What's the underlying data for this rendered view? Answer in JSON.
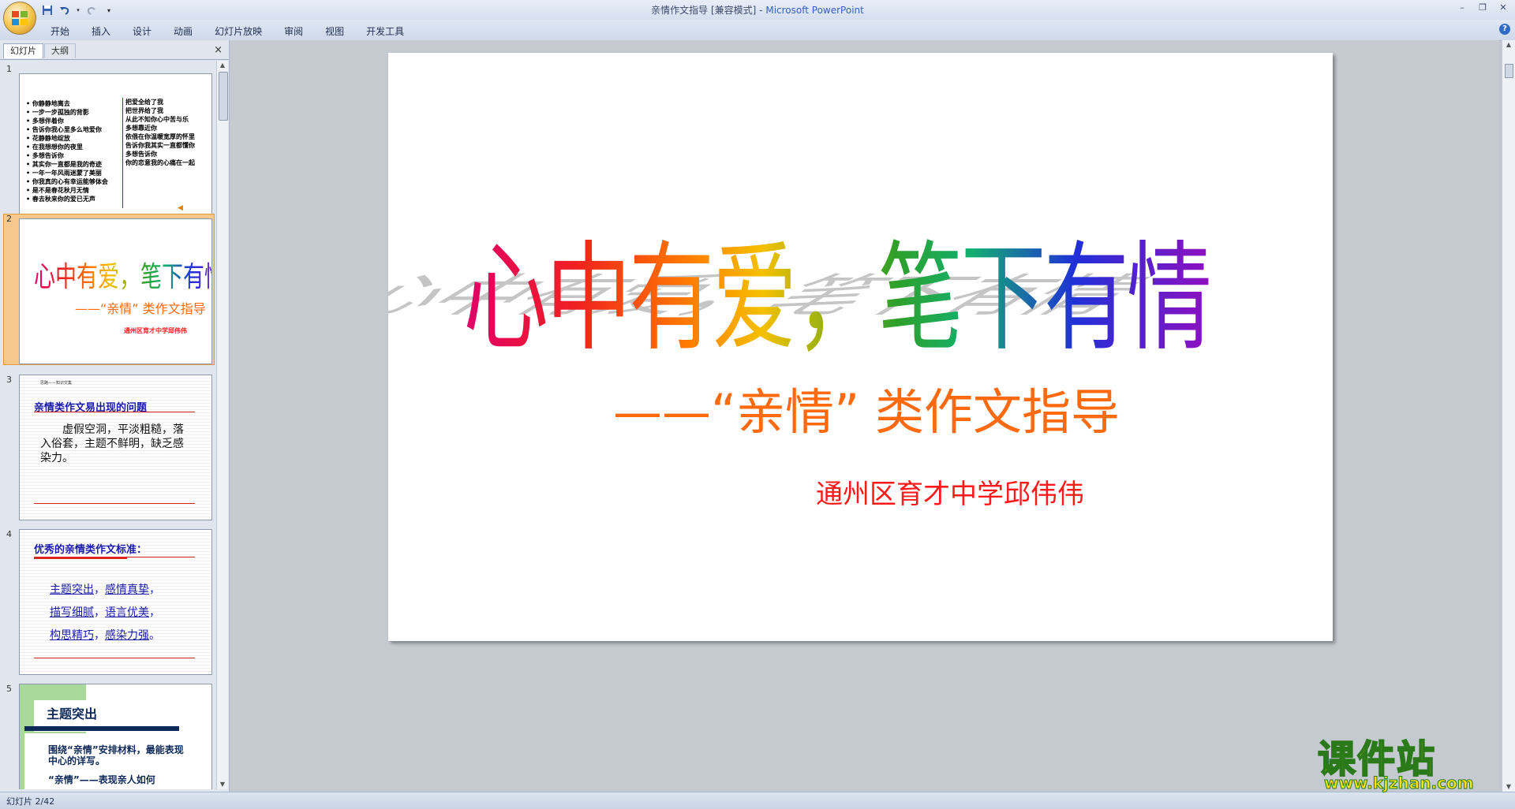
{
  "window": {
    "title_doc": "亲情作文指导 [兼容模式]",
    "title_app": "Microsoft PowerPoint",
    "separator": "-"
  },
  "ribbon": {
    "tabs": [
      "开始",
      "插入",
      "设计",
      "动画",
      "幻灯片放映",
      "审阅",
      "视图",
      "开发工具"
    ]
  },
  "left_panel": {
    "tab_slides": "幻灯片",
    "tab_outline": "大纲",
    "close": "×",
    "slide_numbers": [
      "1",
      "2",
      "3",
      "4",
      "5"
    ],
    "thumb1": {
      "left_lines": [
        "• 你静静地离去",
        "• 一步一步孤独的背影",
        "• 多想伴着你",
        "• 告诉你我心里多么地爱你",
        "• 花静静地绽放",
        "• 在我想想你的夜里",
        "• 多想告诉你",
        "• 其实你一直都是我的奇迹",
        "• 一年一年风雨迷蒙了美丽",
        "• 你我真的心有幸运能够体会",
        "• 是不是春花秋月无情",
        "• 春去秋来你的爱已无声"
      ],
      "right_lines": [
        "把爱全给了我",
        "把世界给了我",
        "从此不知你心中苦与乐",
        "多想靠近你",
        "依偎在你温暖宽厚的怀里",
        "告诉你我其实一直都懂你",
        "多想告诉你",
        "你的恋意我的心痛在一起"
      ]
    },
    "thumb2": {
      "title": "心中有爱，笔下有情",
      "subtitle": "——“亲情” 类作文指导",
      "author": "通州区育才中学邱伟伟"
    },
    "thumb3": {
      "header": "思路——知识交集",
      "title": "亲情类作文易出现的问题",
      "body": "虚假空洞，平淡粗糙，落入俗套，主题不鲜明，缺乏感染力。"
    },
    "thumb4": {
      "title": "优秀的亲情类作文标准：",
      "lines": [
        [
          "主题突出",
          "，",
          "感情真挚",
          "，"
        ],
        [
          "描写细腻",
          "，",
          "语言优美",
          "，"
        ],
        [
          "构思精巧",
          "，",
          "感染力强",
          "。"
        ]
      ]
    },
    "thumb5": {
      "title": "主题突出",
      "body1": "围绕“亲情”安排材料，最能表现中心的详写。",
      "body2": "“亲情”——表现亲人如何"
    }
  },
  "slide": {
    "title": "心中有爱，笔下有情",
    "subtitle": "——“亲情” 类作文指导",
    "author": "通州区育才中学邱伟伟"
  },
  "status": {
    "slide_indicator": "幻灯片 2/42"
  },
  "watermark": {
    "title": "课件站",
    "url": "www.kjzhan.com"
  },
  "colors": {
    "subtitle": "#ff6a10",
    "author": "#ff1a1a",
    "selection": "#f0a04a",
    "ribbon": "#dfe7f3"
  }
}
